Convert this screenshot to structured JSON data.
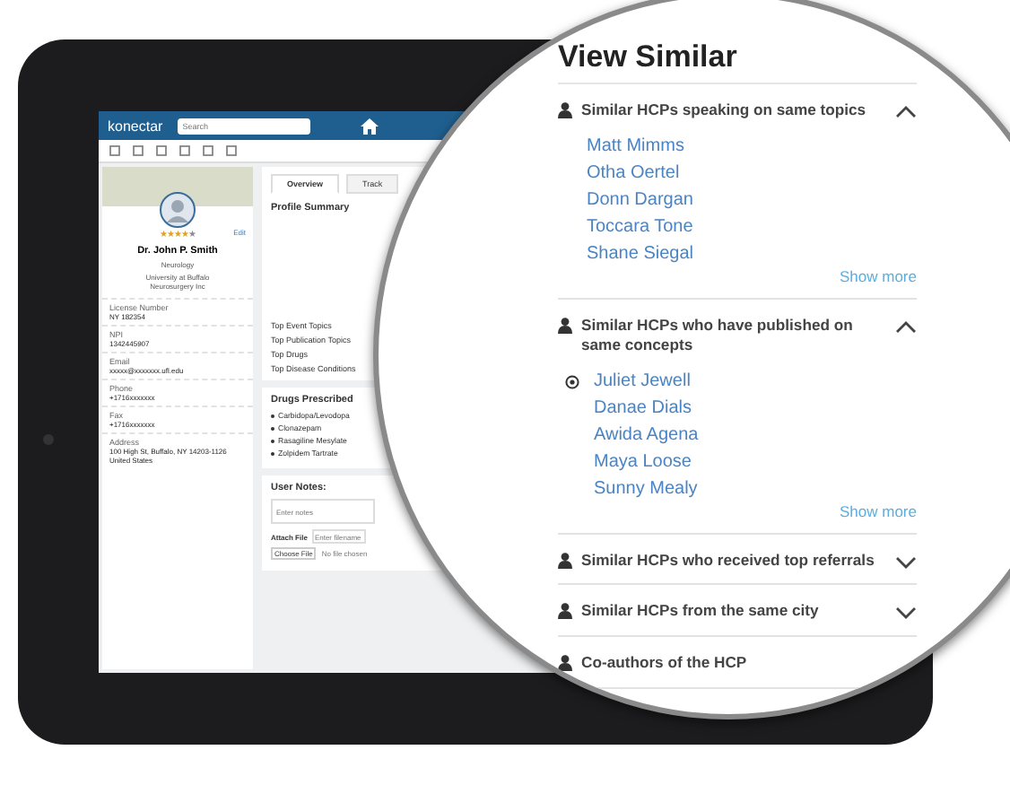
{
  "app": {
    "logo": "konectar",
    "search_placeholder": "Search"
  },
  "profile": {
    "name": "Dr. John P. Smith",
    "specialty": "Neurology",
    "organization": "University at Buffalo Neurosurgery Inc",
    "stars": 4,
    "edit": "Edit",
    "fields": [
      {
        "label": "License Number",
        "value": "NY 182354"
      },
      {
        "label": "NPI",
        "value": "1342445907"
      },
      {
        "label": "Email",
        "value": "xxxxx@xxxxxxx.ufl.edu"
      },
      {
        "label": "Phone",
        "value": "+1716xxxxxxx"
      },
      {
        "label": "Fax",
        "value": "+1716xxxxxxx"
      },
      {
        "label": "Address",
        "value": "100 High St, Buffalo, NY 14203-1126 United States"
      }
    ]
  },
  "tabs": [
    {
      "label": "Overview",
      "selected": true
    },
    {
      "label": "Track",
      "selected": false
    }
  ],
  "summary": {
    "title": "Profile Summary",
    "topics": [
      "Top Event Topics",
      "Top Publication Topics",
      "Top Drugs",
      "Top Disease Conditions"
    ]
  },
  "drugs": {
    "title": "Drugs Prescribed",
    "items": [
      "Carbidopa/Levodopa",
      "Clonazepam",
      "Rasagiline Mesylate",
      "Zolpidem Tartrate"
    ]
  },
  "notes": {
    "title": "User Notes:",
    "placeholder": "Enter notes",
    "attach_label": "Attach File",
    "file_placeholder": "Enter filename",
    "choose": "Choose File",
    "no_file": "No file chosen"
  },
  "view_similar": {
    "title": "View Similar",
    "sections": [
      {
        "title": "Similar HCPs speaking on same topics",
        "expanded": true,
        "people": [
          "Matt Mimms",
          "Otha Oertel",
          "Donn Dargan",
          "Toccara Tone",
          "Shane Siegal"
        ],
        "more": "Show more"
      },
      {
        "title": "Similar HCPs who have published on same concepts",
        "expanded": true,
        "people": [
          "Juliet Jewell",
          "Danae Dials",
          "Awida Agena",
          "Maya Loose",
          "Sunny Mealy"
        ],
        "more": "Show more"
      },
      {
        "title": "Similar HCPs who received top referrals",
        "expanded": false
      },
      {
        "title": "Similar HCPs from the same city",
        "expanded": false
      },
      {
        "title": "Co-authors of the HCP"
      }
    ]
  }
}
